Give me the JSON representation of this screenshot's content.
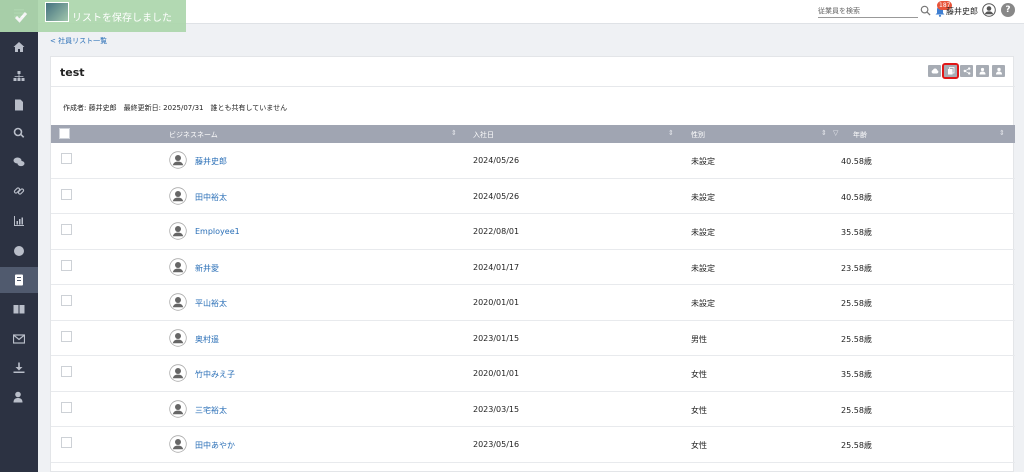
{
  "toast": {
    "message": "リストを保存しました"
  },
  "header": {
    "search_placeholder": "従業員を検索",
    "notification_count": "187",
    "user_name": "藤井史郎",
    "help_label": "?"
  },
  "breadcrumb": "< 社員リスト一覧",
  "page": {
    "title": "test",
    "meta": "作成者: 藤井史郎　最終更新日: 2025/07/31　誰とも共有していません"
  },
  "table": {
    "headers": {
      "name": "ビジネスネーム",
      "joined": "入社日",
      "gender": "性別",
      "age": "年齢"
    },
    "rows": [
      {
        "name": "藤井史郎",
        "joined": "2024/05/26",
        "gender": "未設定",
        "age": "40.58歳"
      },
      {
        "name": "田中裕太",
        "joined": "2024/05/26",
        "gender": "未設定",
        "age": "40.58歳"
      },
      {
        "name": "Employee1",
        "joined": "2022/08/01",
        "gender": "未設定",
        "age": "35.58歳"
      },
      {
        "name": "新井愛",
        "joined": "2024/01/17",
        "gender": "未設定",
        "age": "23.58歳"
      },
      {
        "name": "平山裕太",
        "joined": "2020/01/01",
        "gender": "未設定",
        "age": "25.58歳"
      },
      {
        "name": "奥村遥",
        "joined": "2023/01/15",
        "gender": "男性",
        "age": "25.58歳"
      },
      {
        "name": "竹中みえ子",
        "joined": "2020/01/01",
        "gender": "女性",
        "age": "35.58歳"
      },
      {
        "name": "三宅裕太",
        "joined": "2023/03/15",
        "gender": "女性",
        "age": "25.58歳"
      },
      {
        "name": "田中あやか",
        "joined": "2023/05/16",
        "gender": "女性",
        "age": "25.58歳"
      }
    ]
  }
}
